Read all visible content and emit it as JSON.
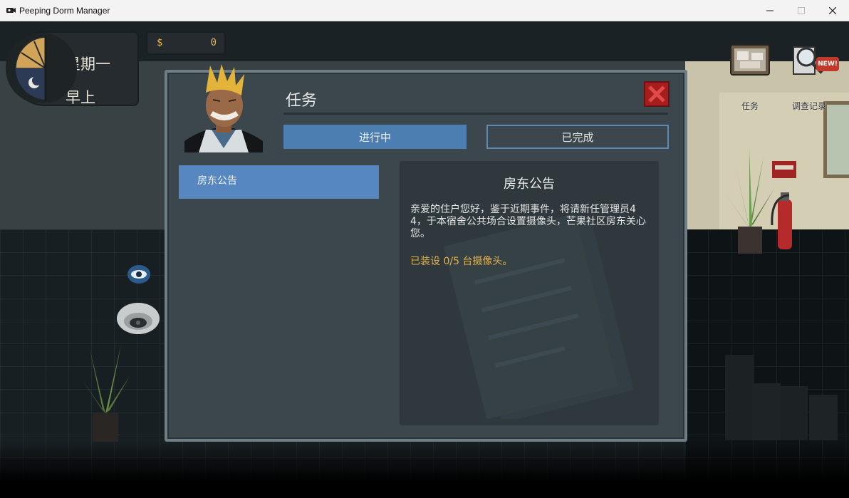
{
  "window": {
    "title": "Peeping Dorm Manager"
  },
  "hud": {
    "day": "星期一",
    "time_of_day": "早上",
    "money_symbol": "$",
    "money_value": "0",
    "tasks_label": "任务",
    "investigation_label": "调查记录",
    "new_badge": "NEW!"
  },
  "modal": {
    "title": "任务",
    "tabs": [
      {
        "label": "进行中",
        "active": true
      },
      {
        "label": "已完成",
        "active": false
      }
    ],
    "quests": [
      {
        "label": "房东公告",
        "selected": true
      }
    ],
    "detail": {
      "title": "房东公告",
      "body": "亲爱的住户您好，鉴于近期事件，将请新任管理员44，于本宿舍公共场合设置摄像头，芒果社区房东关心您。",
      "progress": "已装设 0/5 台摄像头。"
    }
  },
  "colors": {
    "accent_blue": "#4c7eb2",
    "quest_selected": "#5687c0",
    "progress_gold": "#e3b24f",
    "close_red": "#a51d1d"
  }
}
